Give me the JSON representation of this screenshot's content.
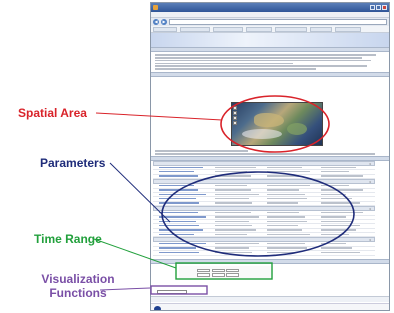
{
  "annotations": {
    "spatial_area": "Spatial Area",
    "parameters": "Parameters",
    "time_range": "Time Range",
    "visualization_functions": "Visualization\nFunctions"
  },
  "colors": {
    "spatial_area": "#d9232a",
    "parameters": "#1f2c7a",
    "time_range": "#22a03c",
    "visualization_functions": "#7a4fa6"
  },
  "browser": {
    "title": "",
    "menu": "",
    "url": "",
    "favorites": [
      "",
      "",
      "",
      "",
      "",
      "",
      ""
    ]
  },
  "page": {
    "banner_title": "",
    "banner_subtitle": "",
    "section_overview": "",
    "section_spatial": "",
    "section_parameters": "",
    "section_time": "",
    "vis_label": "",
    "vis_button": "",
    "generate": "",
    "footer": ""
  },
  "parameter_groups": [
    {
      "rows": 3
    },
    {
      "rows": 5
    },
    {
      "rows": 6
    },
    {
      "rows": 3
    }
  ],
  "time": {
    "start_label": "",
    "end_label": "",
    "start_values": [
      "",
      "",
      ""
    ],
    "end_values": [
      "",
      "",
      ""
    ]
  }
}
